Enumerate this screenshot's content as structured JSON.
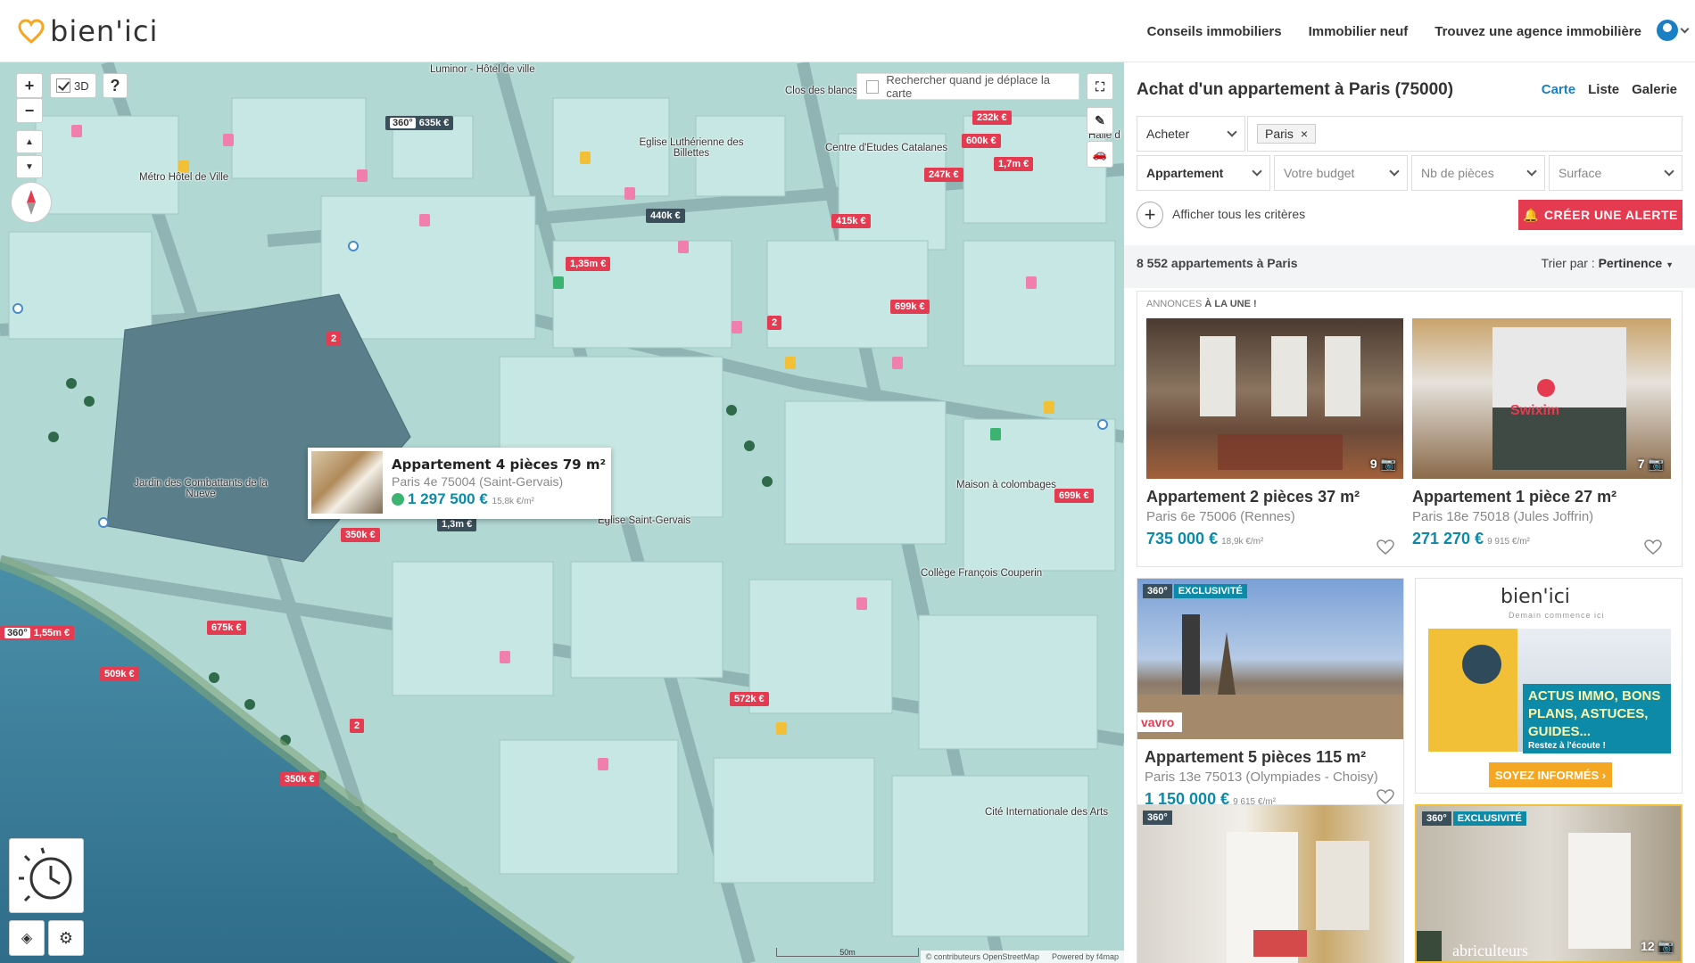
{
  "header": {
    "logo": "bien'ici",
    "nav": [
      "Conseils immobiliers",
      "Immobilier neuf",
      "Trouvez une agence immobilière"
    ]
  },
  "map": {
    "btn_3d": "3D",
    "btn_help": "?",
    "search_on_move": "Rechercher quand je déplace la carte",
    "labels": [
      "Luminor - Hôtel de ville",
      "Clos des blancs manteaux",
      "Eglise Luthérienne des Billettes",
      "Centre d'Etudes Catalanes",
      "Métro Hôtel de Ville",
      "Jardin des Combattants de la Nueve",
      "Eglise Saint-Gervais",
      "Maison à colombages",
      "Collège François Couperin",
      "Cité Internationale des Arts",
      "Halle d"
    ],
    "prices": [
      {
        "label": "635k €",
        "has360": true,
        "t360": "360°"
      },
      {
        "label": "232k €"
      },
      {
        "label": "600k €"
      },
      {
        "label": "1,7m €"
      },
      {
        "label": "247k €"
      },
      {
        "label": "440k €"
      },
      {
        "label": "415k €"
      },
      {
        "label": "1,35m €"
      },
      {
        "label": "699k €"
      },
      {
        "label": "2"
      },
      {
        "label": "2"
      },
      {
        "label": "1,3m €"
      },
      {
        "label": "350k €"
      },
      {
        "label": "699k €"
      },
      {
        "label": "1,55m €",
        "has360": true,
        "t360": "360°"
      },
      {
        "label": "675k €"
      },
      {
        "label": "509k €"
      },
      {
        "label": "572k €"
      },
      {
        "label": "2"
      },
      {
        "label": "350k €"
      }
    ],
    "popup": {
      "title": "Appartement 4 pièces 79 m²",
      "location": "Paris 4e 75004 (Saint-Gervais)",
      "price": "1 297 500 €",
      "price_m2": "15,8k €/m²"
    },
    "scale": "50m",
    "attribution": [
      "© contributeurs OpenStreetMap",
      "Powered by f4map"
    ]
  },
  "panel": {
    "heading": "Achat d'un appartement à Paris (75000)",
    "views": [
      "Carte",
      "Liste",
      "Galerie"
    ],
    "transaction": "Acheter",
    "location_chip": "Paris",
    "location_remove": "×",
    "property_type": "Appartement",
    "budget_placeholder": "Votre budget",
    "rooms_placeholder": "Nb de pièces",
    "surface_placeholder": "Surface",
    "all_criteria": "Afficher tous les critères",
    "alert_btn": "CRÉER UNE ALERTE",
    "results_count": "8 552 appartements à Paris",
    "sort_label": "Trier par : ",
    "sort_value": "Pertinence",
    "featured_label_prefix": "ANNONCES ",
    "featured_label_bold": "À LA UNE !",
    "cards": [
      {
        "title": "Appartement 2 pièces 37 m²",
        "location": "Paris 6e 75006 (Rennes)",
        "price": "735 000 €",
        "price_m2": "18,9k €/m²",
        "photos": "9"
      },
      {
        "title": "Appartement 1 pièce 27 m²",
        "location": "Paris 18e 75018 (Jules Joffrin)",
        "price": "271 270 €",
        "price_m2": "9 915 €/m²",
        "photos": "7"
      },
      {
        "title": "Appartement 5 pièces 115 m²",
        "location": "Paris 13e 75013 (Olympiades - Choisy)",
        "price": "1 150 000 €",
        "price_m2": "9 615 €/m²",
        "badge360": "360°",
        "badge_excl": "EXCLUSIVITÉ",
        "agency": "vavro"
      },
      {
        "badge360": "360°"
      },
      {
        "badge360": "360°",
        "badge_excl": "EXCLUSIVITÉ",
        "photos": "12",
        "agency": "abriculteurs"
      }
    ],
    "featured_store": "Swixim",
    "ad": {
      "logo": "bien'ici",
      "tagline": "Demain commence ici",
      "headline": "ACTUS IMMO, BONS PLANS, ASTUCES, GUIDES...",
      "sub": "Restez à l'écoute !",
      "cta": "SOYEZ INFORMÉS  ›"
    }
  },
  "colors": {
    "accent_blue": "#1b7fc4",
    "price_teal": "#0c8aa8",
    "alert_red": "#e53b50",
    "brand_orange": "#f5a623"
  }
}
